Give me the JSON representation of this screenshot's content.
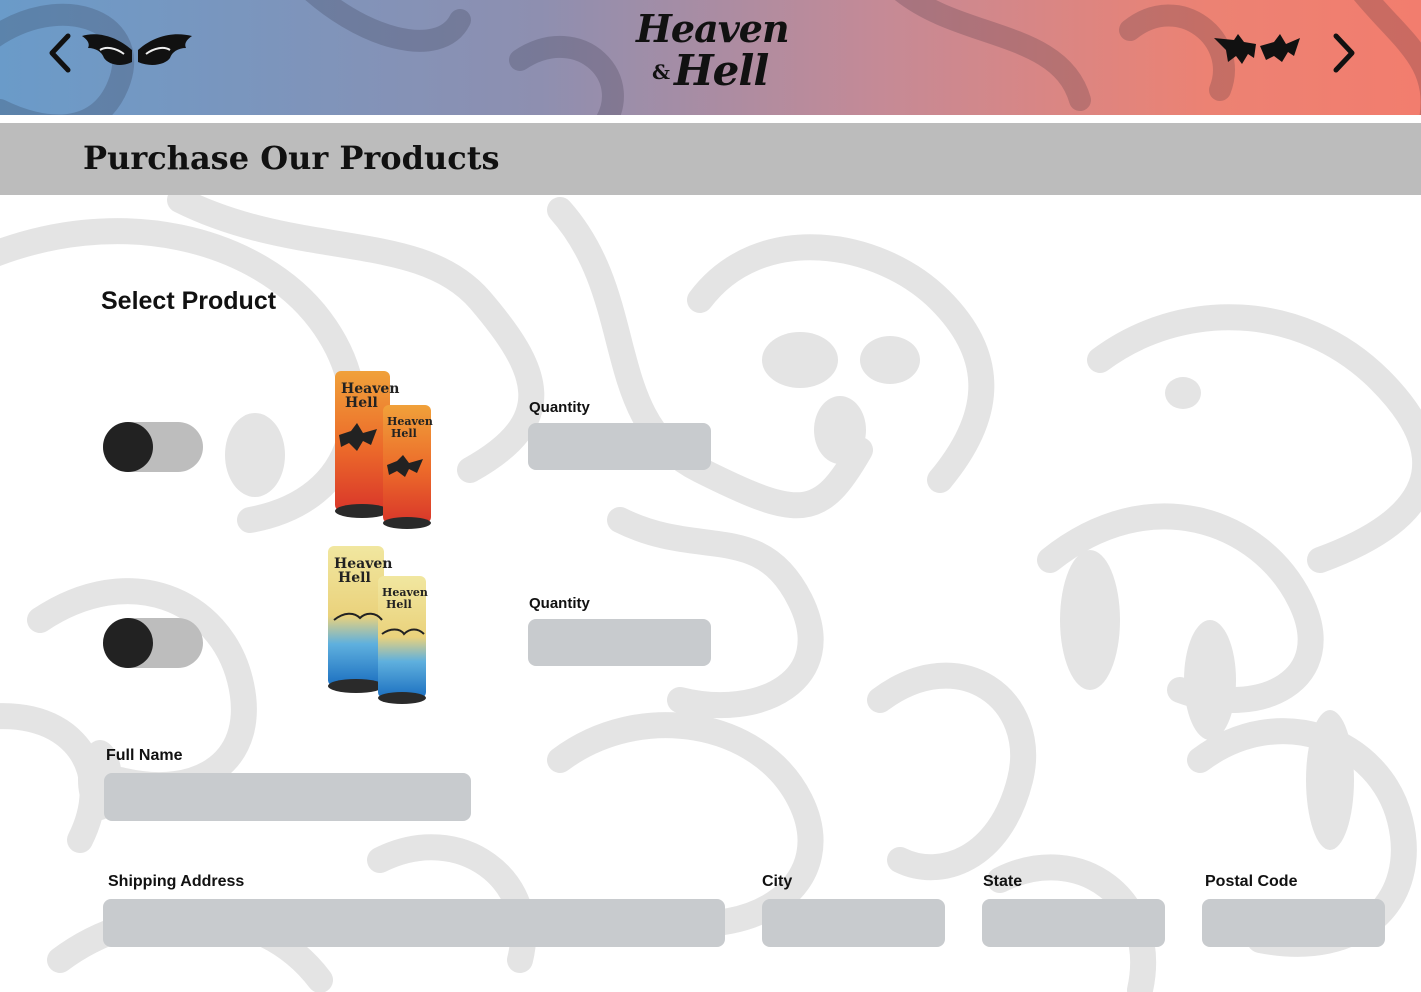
{
  "header": {
    "logo": {
      "line1": "Heaven",
      "ampersand": "&",
      "line2": "Hell"
    },
    "nav_prev_icon": "angel-wings-chevron-left-icon",
    "nav_next_icon": "bat-wings-chevron-right-icon"
  },
  "page": {
    "title": "Purchase Our Products"
  },
  "form": {
    "section_heading": "Select Product",
    "products": [
      {
        "image_icon": "orange-red-cans-image",
        "toggle_on": false,
        "quantity_label": "Quantity",
        "quantity_value": ""
      },
      {
        "image_icon": "yellow-blue-cans-image",
        "toggle_on": false,
        "quantity_label": "Quantity",
        "quantity_value": ""
      }
    ],
    "full_name": {
      "label": "Full Name",
      "value": ""
    },
    "shipping_address": {
      "label": "Shipping Address",
      "value": ""
    },
    "city": {
      "label": "City",
      "value": ""
    },
    "state": {
      "label": "State",
      "value": ""
    },
    "postal_code": {
      "label": "Postal Code",
      "value": ""
    }
  },
  "colors": {
    "header_gradient_start": "#6a9bc9",
    "header_gradient_end": "#f27d6e",
    "title_bar": "#bcbcbc",
    "input_fill": "#c8cbce",
    "toggle_track": "#bdbdbd",
    "toggle_knob": "#222222",
    "pattern": "#e4e4e4"
  }
}
